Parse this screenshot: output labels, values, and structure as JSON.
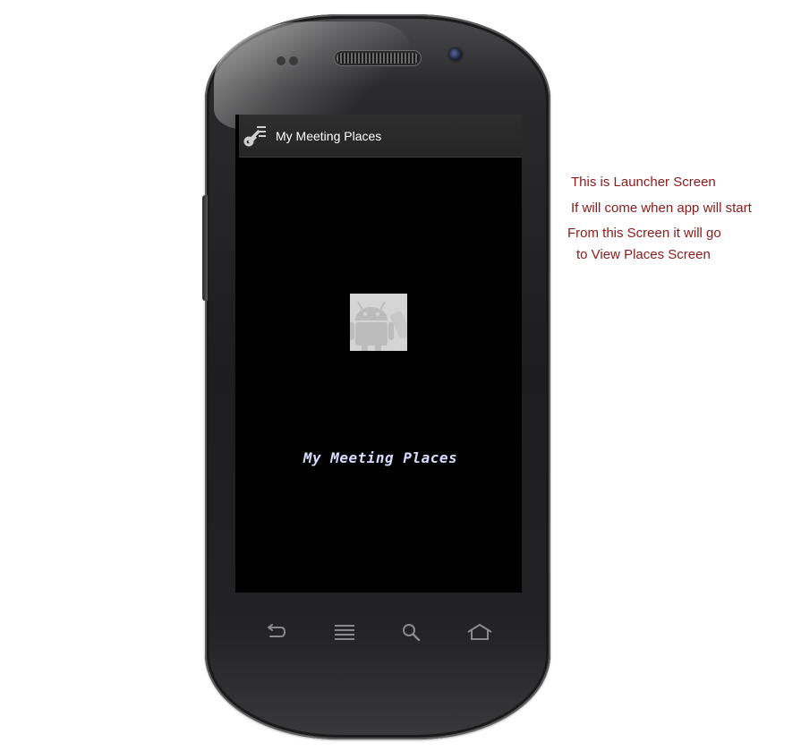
{
  "app": {
    "title": "My Meeting Places",
    "icon": "key-icon"
  },
  "splash": {
    "image": "android-robot-icon",
    "text": "My Meeting Places"
  },
  "device": {
    "nav_keys": [
      "back-icon",
      "menu-icon",
      "search-icon",
      "home-icon"
    ]
  },
  "annotation": {
    "lines": [
      "This is Launcher Screen",
      "If will come when app will start",
      "From this Screen it will go",
      "to View Places Screen"
    ],
    "color": "#8b1a1a"
  }
}
